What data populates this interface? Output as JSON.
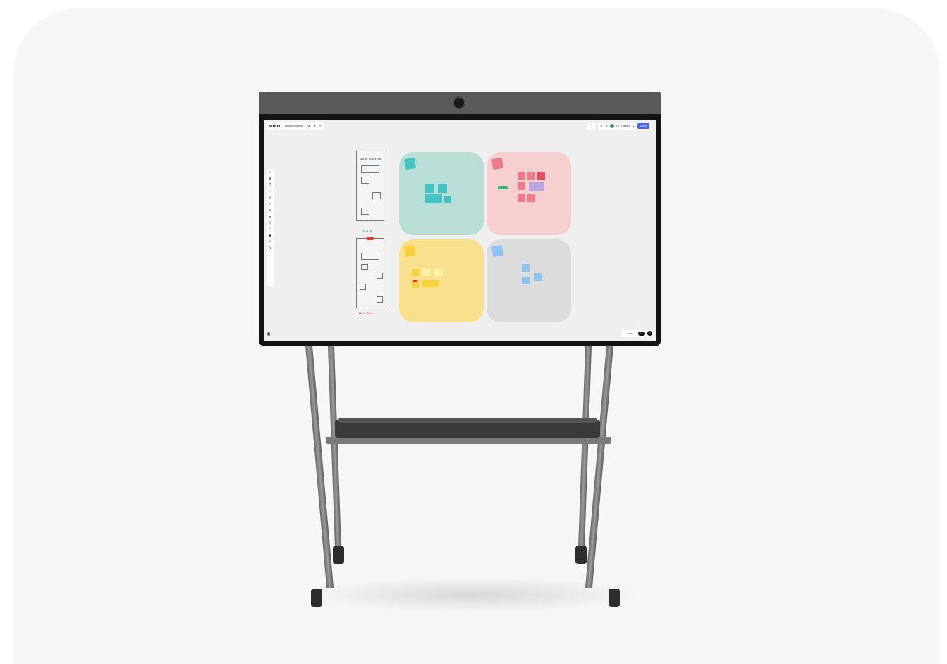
{
  "toolbar_top": {
    "brand": "miro",
    "board_name": "Weekly Meeting",
    "settings_icon": "gear-icon",
    "export_icon": "upload-icon",
    "search_icon": "search-icon"
  },
  "toolbar_right": {
    "present_label": "Present",
    "share_label": "Share"
  },
  "frames": [
    {
      "title": "",
      "color": "#b9ded6",
      "note_color": "#45c2c2"
    },
    {
      "title": "",
      "color": "#f6cfd0",
      "note_color": "#ef7a8a"
    },
    {
      "title": "",
      "color": "#f9e08f",
      "note_color": "#f6d23c"
    },
    {
      "title": "",
      "color": "#dcdcdc",
      "note_color": "#8ec3f4"
    }
  ],
  "sketch": {
    "heading": "All in one Plan",
    "footer_1": "Toolkit",
    "footer_2": "Next Step"
  },
  "bottom_bar": {
    "zoom_value": "100%"
  },
  "colors": {
    "share_blue": "#4262ff",
    "teal_frame": "#b9ded6",
    "pink_frame": "#f6cfd0",
    "yellow_frame": "#f9e08f",
    "gray_frame": "#dcdcdc"
  }
}
